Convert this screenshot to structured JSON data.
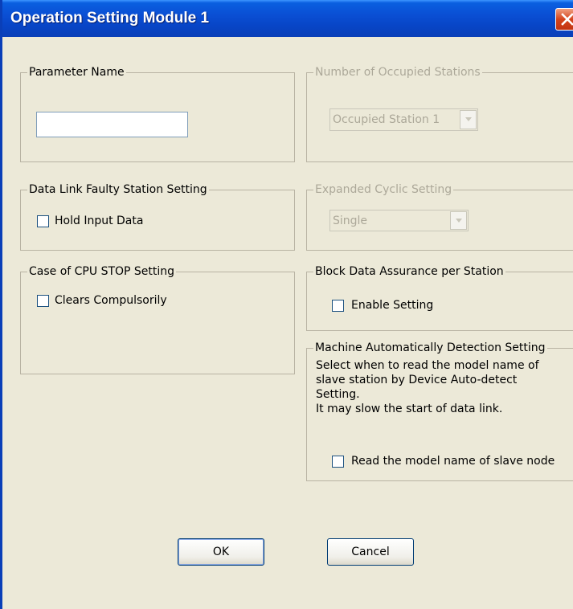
{
  "window": {
    "title": "Operation Setting Module 1"
  },
  "parameter_name": {
    "legend": "Parameter Name",
    "value": ""
  },
  "occupied_stations": {
    "legend": "Number of Occupied Stations",
    "selected": "Occupied Station 1",
    "enabled": false
  },
  "faulty_station": {
    "legend": "Data Link Faulty Station Setting",
    "checkbox_label": "Hold Input Data",
    "checked": false
  },
  "expanded_cyclic": {
    "legend": "Expanded Cyclic Setting",
    "selected": "Single",
    "enabled": false
  },
  "cpu_stop": {
    "legend": "Case of CPU STOP Setting",
    "checkbox_label": "Clears Compulsorily",
    "checked": false
  },
  "block_data": {
    "legend": "Block Data Assurance per Station",
    "checkbox_label": "Enable Setting",
    "checked": false
  },
  "machine_detection": {
    "legend": "Machine Automatically Detection Setting",
    "description": [
      "Select when to read the model name of",
      "slave station by Device Auto-detect",
      "Setting.",
      "It may slow the start of data link."
    ],
    "checkbox_label": "Read the model name of slave node",
    "checked": false
  },
  "buttons": {
    "ok": "OK",
    "cancel": "Cancel"
  },
  "colors": {
    "title_bar": "#0a4fd4",
    "dialog_bg": "#ece9d8",
    "disabled_text": "#aca899"
  }
}
